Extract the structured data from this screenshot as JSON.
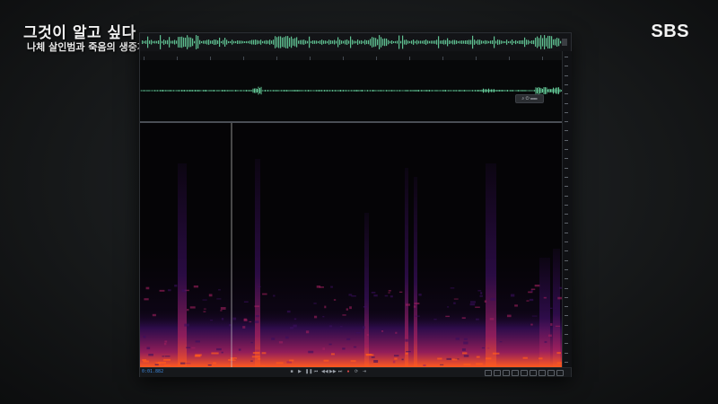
{
  "broadcast": {
    "show_title": "그것이 알고 싶다",
    "episode_subtitle": "나체 살인범과 죽음의 생중계",
    "channel_logo": "SBS"
  },
  "editor": {
    "time_readout": "0:01.882",
    "zoom_control_label": "⌕ ⏻ ▭▭",
    "transport_buttons": [
      {
        "icon": "stop-icon",
        "glyph": "■"
      },
      {
        "icon": "play-icon",
        "glyph": "▶"
      },
      {
        "icon": "pause-icon",
        "glyph": "❚❚"
      },
      {
        "icon": "skip-back-icon",
        "glyph": "⏮"
      },
      {
        "icon": "rewind-icon",
        "glyph": "◀◀"
      },
      {
        "icon": "fast-forward-icon",
        "glyph": "▶▶"
      },
      {
        "icon": "skip-forward-icon",
        "glyph": "⏭"
      },
      {
        "icon": "record-icon",
        "glyph": "●"
      },
      {
        "icon": "loop-icon",
        "glyph": "⟳"
      },
      {
        "icon": "skip-selection-icon",
        "glyph": "⇥"
      }
    ],
    "colors": {
      "waveform": "#6fe0a8",
      "spectrum_low": "#3a0f5e",
      "spectrum_mid": "#a0205e",
      "spectrum_high": "#ff5a1e",
      "playhead": "#d8d8d8"
    }
  }
}
